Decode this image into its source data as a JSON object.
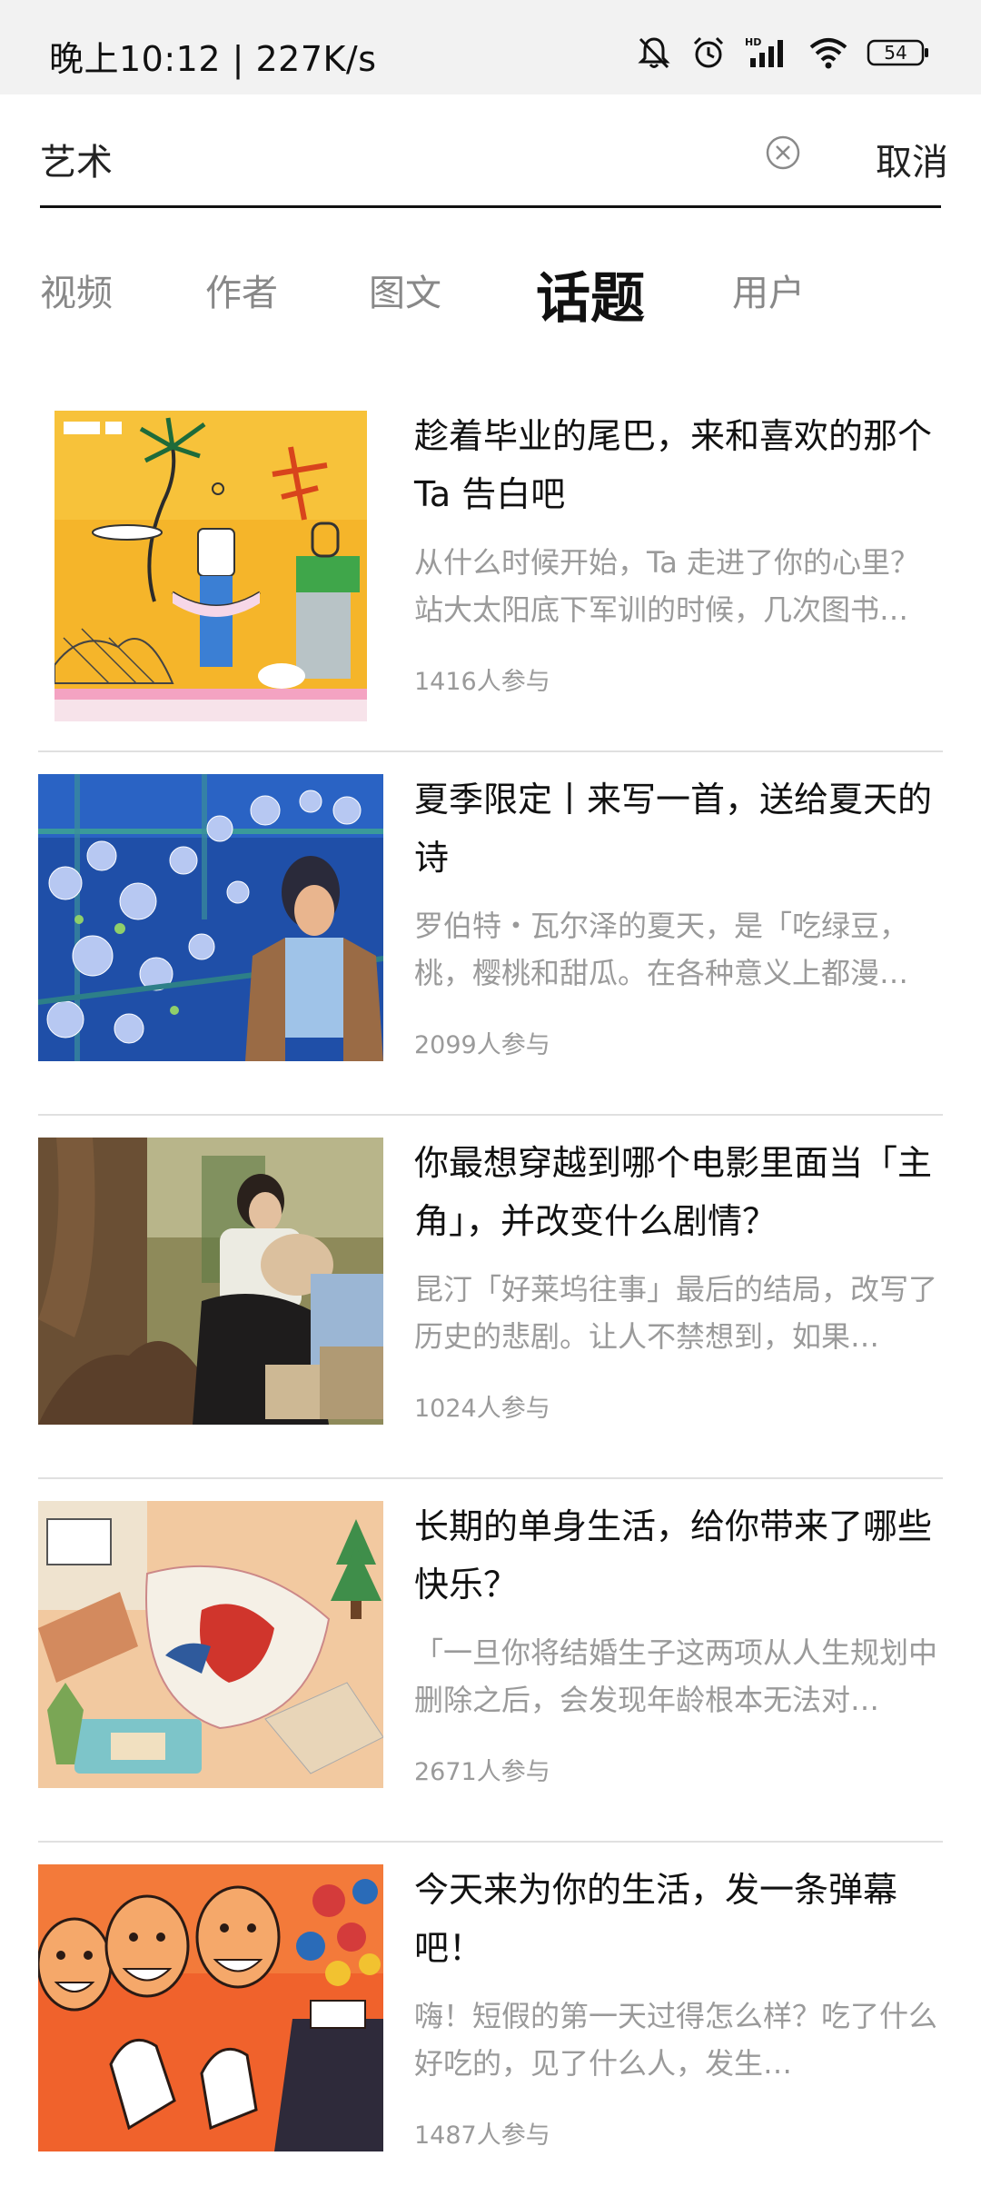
{
  "status_bar": {
    "time": "晚上10:12 | 227K/s",
    "battery": "54",
    "network_label": "HD"
  },
  "search": {
    "query": "艺术",
    "cancel_label": "取消"
  },
  "tabs": [
    {
      "label": "视频",
      "active": false
    },
    {
      "label": "作者",
      "active": false
    },
    {
      "label": "图文",
      "active": false
    },
    {
      "label": "话题",
      "active": true
    },
    {
      "label": "用户",
      "active": false
    }
  ],
  "topics": [
    {
      "title": "趁着毕业的尾巴，来和喜欢的那个 Ta 告白吧",
      "desc": "从什么时候开始，Ta 走进了你的心里？站大太阳底下军训的时候，几次图书…",
      "count": "1416人参与"
    },
    {
      "title": "夏季限定丨来写一首，送给夏天的诗",
      "desc": "罗伯特・瓦尔泽的夏天，是「吃绿豆，桃，樱桃和甜瓜。在各种意义上都漫…",
      "count": "2099人参与"
    },
    {
      "title": "你最想穿越到哪个电影里面当「主角」，并改变什么剧情？",
      "desc": "昆汀「好莱坞往事」最后的结局，改写了历史的悲剧。让人不禁想到，如果…",
      "count": "1024人参与"
    },
    {
      "title": "长期的单身生活，给你带来了哪些快乐？",
      "desc": "「一旦你将结婚生子这两项从人生规划中删除之后，会发现年龄根本无法对…",
      "count": "2671人参与"
    },
    {
      "title": "今天来为你的生活，发一条弹幕吧！",
      "desc": "嗨！短假的第一天过得怎么样？吃了什么好吃的，见了什么人，发生…",
      "count": "1487人参与"
    }
  ]
}
